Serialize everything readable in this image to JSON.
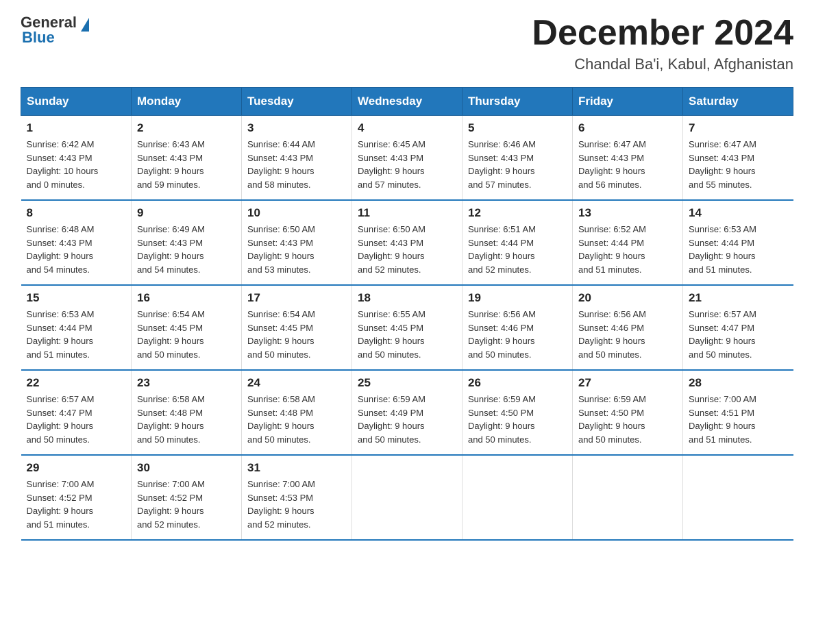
{
  "logo": {
    "general": "General",
    "blue": "Blue"
  },
  "title": "December 2024",
  "location": "Chandal Ba'i, Kabul, Afghanistan",
  "days_of_week": [
    "Sunday",
    "Monday",
    "Tuesday",
    "Wednesday",
    "Thursday",
    "Friday",
    "Saturday"
  ],
  "weeks": [
    [
      {
        "day": "1",
        "sunrise": "6:42 AM",
        "sunset": "4:43 PM",
        "daylight": "10 hours and 0 minutes."
      },
      {
        "day": "2",
        "sunrise": "6:43 AM",
        "sunset": "4:43 PM",
        "daylight": "9 hours and 59 minutes."
      },
      {
        "day": "3",
        "sunrise": "6:44 AM",
        "sunset": "4:43 PM",
        "daylight": "9 hours and 58 minutes."
      },
      {
        "day": "4",
        "sunrise": "6:45 AM",
        "sunset": "4:43 PM",
        "daylight": "9 hours and 57 minutes."
      },
      {
        "day": "5",
        "sunrise": "6:46 AM",
        "sunset": "4:43 PM",
        "daylight": "9 hours and 57 minutes."
      },
      {
        "day": "6",
        "sunrise": "6:47 AM",
        "sunset": "4:43 PM",
        "daylight": "9 hours and 56 minutes."
      },
      {
        "day": "7",
        "sunrise": "6:47 AM",
        "sunset": "4:43 PM",
        "daylight": "9 hours and 55 minutes."
      }
    ],
    [
      {
        "day": "8",
        "sunrise": "6:48 AM",
        "sunset": "4:43 PM",
        "daylight": "9 hours and 54 minutes."
      },
      {
        "day": "9",
        "sunrise": "6:49 AM",
        "sunset": "4:43 PM",
        "daylight": "9 hours and 54 minutes."
      },
      {
        "day": "10",
        "sunrise": "6:50 AM",
        "sunset": "4:43 PM",
        "daylight": "9 hours and 53 minutes."
      },
      {
        "day": "11",
        "sunrise": "6:50 AM",
        "sunset": "4:43 PM",
        "daylight": "9 hours and 52 minutes."
      },
      {
        "day": "12",
        "sunrise": "6:51 AM",
        "sunset": "4:44 PM",
        "daylight": "9 hours and 52 minutes."
      },
      {
        "day": "13",
        "sunrise": "6:52 AM",
        "sunset": "4:44 PM",
        "daylight": "9 hours and 51 minutes."
      },
      {
        "day": "14",
        "sunrise": "6:53 AM",
        "sunset": "4:44 PM",
        "daylight": "9 hours and 51 minutes."
      }
    ],
    [
      {
        "day": "15",
        "sunrise": "6:53 AM",
        "sunset": "4:44 PM",
        "daylight": "9 hours and 51 minutes."
      },
      {
        "day": "16",
        "sunrise": "6:54 AM",
        "sunset": "4:45 PM",
        "daylight": "9 hours and 50 minutes."
      },
      {
        "day": "17",
        "sunrise": "6:54 AM",
        "sunset": "4:45 PM",
        "daylight": "9 hours and 50 minutes."
      },
      {
        "day": "18",
        "sunrise": "6:55 AM",
        "sunset": "4:45 PM",
        "daylight": "9 hours and 50 minutes."
      },
      {
        "day": "19",
        "sunrise": "6:56 AM",
        "sunset": "4:46 PM",
        "daylight": "9 hours and 50 minutes."
      },
      {
        "day": "20",
        "sunrise": "6:56 AM",
        "sunset": "4:46 PM",
        "daylight": "9 hours and 50 minutes."
      },
      {
        "day": "21",
        "sunrise": "6:57 AM",
        "sunset": "4:47 PM",
        "daylight": "9 hours and 50 minutes."
      }
    ],
    [
      {
        "day": "22",
        "sunrise": "6:57 AM",
        "sunset": "4:47 PM",
        "daylight": "9 hours and 50 minutes."
      },
      {
        "day": "23",
        "sunrise": "6:58 AM",
        "sunset": "4:48 PM",
        "daylight": "9 hours and 50 minutes."
      },
      {
        "day": "24",
        "sunrise": "6:58 AM",
        "sunset": "4:48 PM",
        "daylight": "9 hours and 50 minutes."
      },
      {
        "day": "25",
        "sunrise": "6:59 AM",
        "sunset": "4:49 PM",
        "daylight": "9 hours and 50 minutes."
      },
      {
        "day": "26",
        "sunrise": "6:59 AM",
        "sunset": "4:50 PM",
        "daylight": "9 hours and 50 minutes."
      },
      {
        "day": "27",
        "sunrise": "6:59 AM",
        "sunset": "4:50 PM",
        "daylight": "9 hours and 50 minutes."
      },
      {
        "day": "28",
        "sunrise": "7:00 AM",
        "sunset": "4:51 PM",
        "daylight": "9 hours and 51 minutes."
      }
    ],
    [
      {
        "day": "29",
        "sunrise": "7:00 AM",
        "sunset": "4:52 PM",
        "daylight": "9 hours and 51 minutes."
      },
      {
        "day": "30",
        "sunrise": "7:00 AM",
        "sunset": "4:52 PM",
        "daylight": "9 hours and 52 minutes."
      },
      {
        "day": "31",
        "sunrise": "7:00 AM",
        "sunset": "4:53 PM",
        "daylight": "9 hours and 52 minutes."
      },
      null,
      null,
      null,
      null
    ]
  ],
  "labels": {
    "sunrise": "Sunrise:",
    "sunset": "Sunset:",
    "daylight": "Daylight:"
  }
}
